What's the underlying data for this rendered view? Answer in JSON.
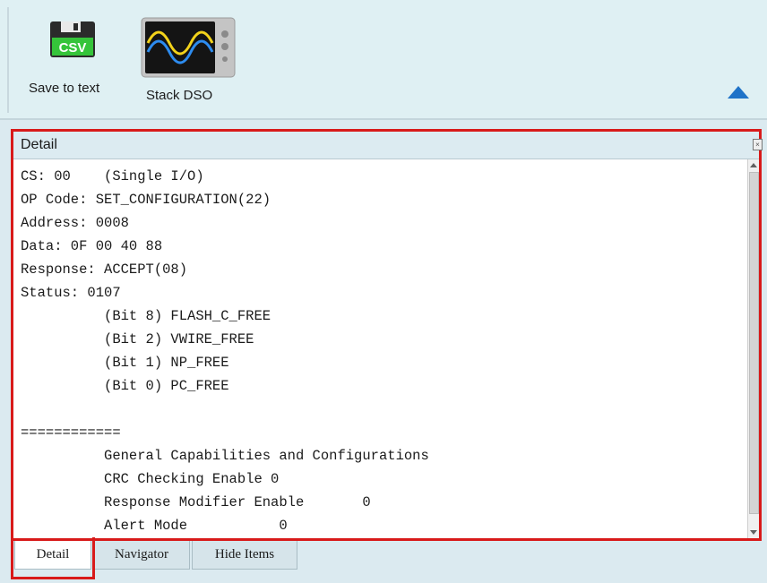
{
  "toolbar": {
    "save_to_text": {
      "label": "Save to text",
      "icon": "csv-floppy-icon",
      "badge": "CSV"
    },
    "stack_dso": {
      "label": "Stack DSO",
      "icon": "oscilloscope-icon"
    },
    "collapse_icon": "collapse-ribbon-icon",
    "accent_color": "#1f73c8"
  },
  "panel": {
    "title": "Detail",
    "highlight_color": "#d81a1a",
    "lines": [
      "CS: 00    (Single I/O)",
      "OP Code: SET_CONFIGURATION(22)",
      "Address: 0008",
      "Data: 0F 00 40 88",
      "Response: ACCEPT(08)",
      "Status: 0107",
      "          (Bit 8) FLASH_C_FREE",
      "          (Bit 2) VWIRE_FREE",
      "          (Bit 1) NP_FREE",
      "          (Bit 0) PC_FREE",
      "",
      "============",
      "          General Capabilities and Configurations",
      "          CRC Checking Enable 0",
      "          Response Modifier Enable       0",
      "          Alert Mode           0"
    ]
  },
  "tabs": [
    {
      "label": "Detail",
      "active": true
    },
    {
      "label": "Navigator",
      "active": false
    },
    {
      "label": "Hide Items",
      "active": false
    }
  ]
}
